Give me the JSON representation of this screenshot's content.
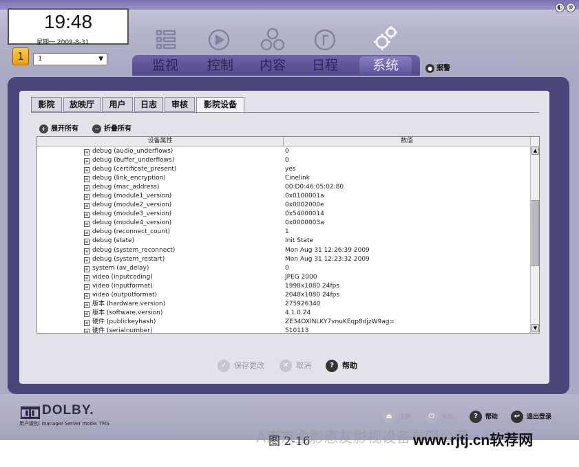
{
  "window": {
    "minimize_icon": "◐",
    "close_icon": "⊗"
  },
  "clock": {
    "time": "19:48",
    "date": "星期一 2009-8-31"
  },
  "screen_selector": {
    "number": "1",
    "value": "1"
  },
  "nav": {
    "tabs": [
      "监视",
      "控制",
      "内容",
      "日程",
      "系统"
    ],
    "active": "系统",
    "alarm_label": "报警"
  },
  "content_tabs": [
    "影院",
    "放映厅",
    "用户",
    "日志",
    "审核",
    "影院设备"
  ],
  "active_content_tab": "影院设备",
  "toolbar": {
    "expand_all": "展开所有",
    "collapse_all": "折叠所有"
  },
  "table": {
    "headers": [
      "设备属性",
      "数值"
    ],
    "rows": [
      [
        "debug (audio_underflows)",
        "0"
      ],
      [
        "debug (buffer_underflows)",
        "0"
      ],
      [
        "debug (certificate_present)",
        "yes"
      ],
      [
        "debug (link_encryption)",
        "Cinelink"
      ],
      [
        "debug (mac_address)",
        "00:D0:46:05:02:80"
      ],
      [
        "debug (module1_version)",
        "0x0100001a"
      ],
      [
        "debug (module2_version)",
        "0x0002000e"
      ],
      [
        "debug (module3_version)",
        "0x54000014"
      ],
      [
        "debug (module4_version)",
        "0x0000003a"
      ],
      [
        "debug (reconnect_count)",
        "1"
      ],
      [
        "debug (state)",
        "Init State"
      ],
      [
        "debug (system_reconnect)",
        "Mon Aug 31 12:26:39 2009"
      ],
      [
        "debug (system_restart)",
        "Mon Aug 31 12:23:32 2009"
      ],
      [
        "system (av_delay)",
        "0"
      ],
      [
        "video (inputcoding)",
        "JPEG 2000"
      ],
      [
        "video (inputformat)",
        "1998x1080 24fps"
      ],
      [
        "video (outputformat)",
        "2048x1080 24fps"
      ],
      [
        "版本 (hardware.version)",
        "275926340"
      ],
      [
        "版本 (software.version)",
        "4.1.0.24"
      ],
      [
        "硬件 (publickeyhash)",
        "ZE34OXINLKY7vnuKEqp8djzW9ag="
      ],
      [
        "硬件 (serialnumber)",
        "510113"
      ]
    ]
  },
  "actions": {
    "save": "保存更改",
    "cancel": "取消",
    "help": "帮助"
  },
  "footer": {
    "brand": "DOLBY.",
    "user_info": "用户级别: manager   Server mode: TMS",
    "buttons": [
      "注销",
      "关机",
      "帮助",
      "退出登录"
    ]
  },
  "caption": "图 2-16",
  "watermark": {
    "left": "A南京金影惠友影视设备有限公司",
    "right": "www.rjtj.cn软荐网"
  }
}
